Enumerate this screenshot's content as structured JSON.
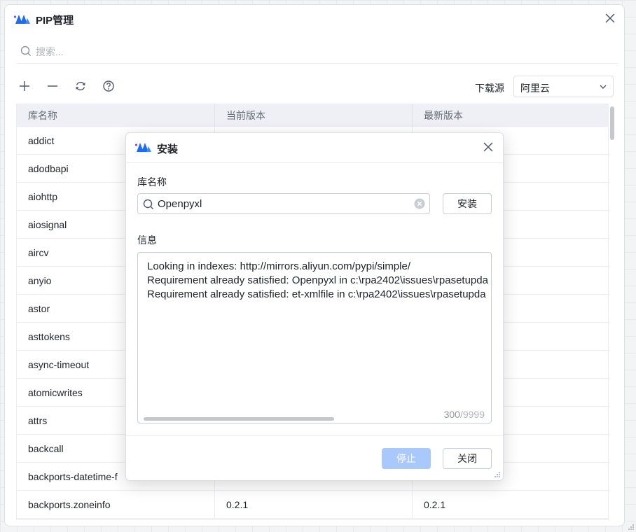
{
  "window": {
    "title": "PIP管理"
  },
  "search": {
    "placeholder": "搜索..."
  },
  "toolbar": {
    "add": "add",
    "remove": "remove",
    "refresh": "refresh",
    "help": "help",
    "source_label": "下载源",
    "source_value": "阿里云"
  },
  "table": {
    "headers": [
      "库名称",
      "当前版本",
      "最新版本"
    ],
    "rows": [
      [
        "addict",
        "",
        ""
      ],
      [
        "adodbapi",
        "",
        ""
      ],
      [
        "aiohttp",
        "",
        ""
      ],
      [
        "aiosignal",
        "",
        ""
      ],
      [
        "aircv",
        "",
        ""
      ],
      [
        "anyio",
        "",
        ""
      ],
      [
        "astor",
        "",
        ""
      ],
      [
        "asttokens",
        "",
        ""
      ],
      [
        "async-timeout",
        "",
        ""
      ],
      [
        "atomicwrites",
        "",
        ""
      ],
      [
        "attrs",
        "",
        ""
      ],
      [
        "backcall",
        "",
        ""
      ],
      [
        "backports-datetime-f",
        "",
        ""
      ],
      [
        "backports.zoneinfo",
        "0.2.1",
        "0.2.1"
      ]
    ]
  },
  "modal": {
    "title": "安装",
    "name_label": "库名称",
    "name_value": "Openpyxl",
    "install_label": "安装",
    "info_label": "信息",
    "log_lines": [
      "Looking in indexes: http://mirrors.aliyun.com/pypi/simple/",
      "Requirement already satisfied: Openpyxl in c:\\rpa2402\\issues\\rpasetupda",
      "Requirement already satisfied: et-xmlfile in c:\\rpa2402\\issues\\rpasetupda"
    ],
    "char_count": "300",
    "char_sep": "/",
    "char_max": "9999",
    "stop_label": "停止",
    "close_label": "关闭"
  },
  "colors": {
    "accent": "#1e6cf5",
    "stop_disabled": "#a9c8fb",
    "header_bg": "#eef0f5"
  }
}
